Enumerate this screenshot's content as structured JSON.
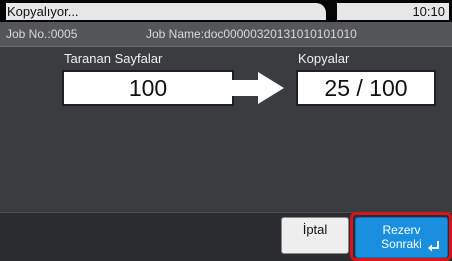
{
  "status": {
    "title": "Kopyalıyor...",
    "time": "10:10"
  },
  "job": {
    "number": "Job No.:0005",
    "name": "Job Name:doc00000320131010101010"
  },
  "scanned": {
    "label": "Taranan Sayfalar",
    "value": "100"
  },
  "copies": {
    "label": "Kopyalar",
    "value": "25 / 100"
  },
  "buttons": {
    "cancel": "İptal",
    "reserve_line1": "Rezerv",
    "reserve_line2": "Sonraki"
  },
  "colors": {
    "accent": "#1a8fe0",
    "highlight": "#d7131f"
  },
  "icons": {
    "arrow": "right-arrow-icon",
    "enter": "enter-icon"
  }
}
